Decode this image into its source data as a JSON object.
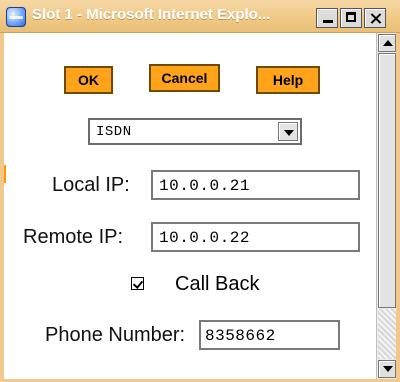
{
  "window": {
    "title": "Slot 1 - Microsoft Internet Explo..."
  },
  "buttons": {
    "ok": "OK",
    "cancel": "Cancel",
    "help": "Help"
  },
  "connection_type": {
    "selected": "ISDN"
  },
  "fields": {
    "local_ip": {
      "label": "Local IP:",
      "value": "10.0.0.21"
    },
    "remote_ip": {
      "label": "Remote IP:",
      "value": "10.0.0.22"
    },
    "phone_number": {
      "label": "Phone Number:",
      "value": "8358662"
    }
  },
  "call_back": {
    "label": "Call Back",
    "checked": true
  },
  "colors": {
    "button_bg": "#ffa31a",
    "titlebar": "#f0c884"
  }
}
